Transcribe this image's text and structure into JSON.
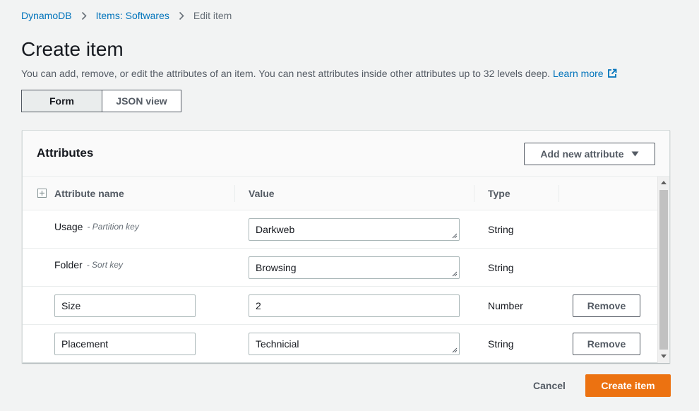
{
  "breadcrumb": {
    "items": [
      {
        "label": "DynamoDB"
      },
      {
        "label": "Items: Softwares"
      },
      {
        "label": "Edit item"
      }
    ]
  },
  "page": {
    "title": "Create item",
    "description": "You can add, remove, or edit the attributes of an item. You can nest attributes inside other attributes up to 32 levels deep.",
    "learn_more": "Learn more"
  },
  "view_toggle": {
    "form_label": "Form",
    "json_label": "JSON view",
    "selected": "Form"
  },
  "attributes": {
    "title": "Attributes",
    "add_button_label": "Add new attribute",
    "columns": {
      "name": "Attribute name",
      "value": "Value",
      "type": "Type"
    },
    "rows": [
      {
        "name": "Usage",
        "hint": "- Partition key",
        "value": "Darkweb",
        "type": "String"
      },
      {
        "name": "Folder",
        "hint": "- Sort key",
        "value": "Browsing",
        "type": "String"
      },
      {
        "name": "Size",
        "value": "2",
        "type": "Number",
        "remove_label": "Remove"
      },
      {
        "name": "Placement",
        "value": "Technicial",
        "type": "String",
        "remove_label": "Remove"
      }
    ]
  },
  "footer": {
    "cancel_label": "Cancel",
    "create_label": "Create item"
  },
  "colors": {
    "link": "#0073bb",
    "primary_button": "#ec7211",
    "text": "#16191f",
    "muted": "#545b64"
  },
  "icons": [
    "chevron-right-icon",
    "external-link-icon",
    "caret-down-icon",
    "expand-square-icon",
    "resize-handle-icon",
    "scroll-up-icon",
    "scroll-down-icon"
  ]
}
